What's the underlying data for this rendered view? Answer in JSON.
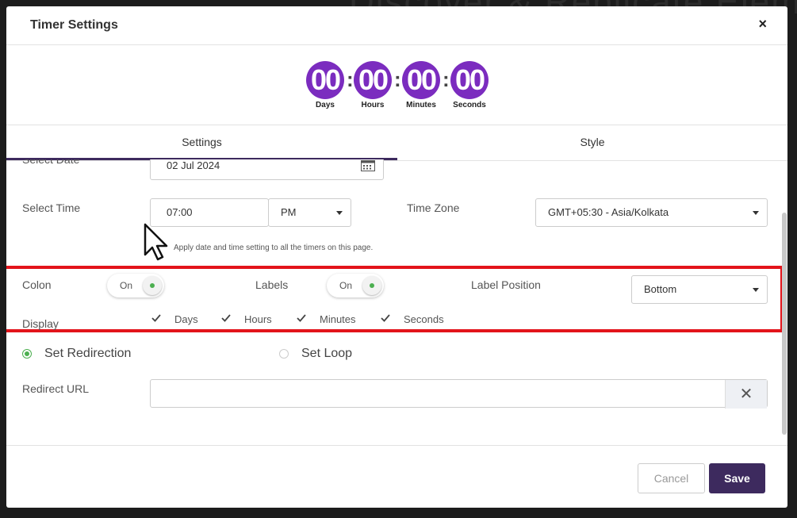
{
  "background_heading": "Discover & Replicate Elem",
  "modal": {
    "title": "Timer Settings",
    "close_glyph": "×"
  },
  "preview": {
    "units": [
      {
        "value": "00",
        "label": "Days"
      },
      {
        "value": "00",
        "label": "Hours"
      },
      {
        "value": "00",
        "label": "Minutes"
      },
      {
        "value": "00",
        "label": "Seconds"
      }
    ],
    "separator": ":",
    "accent_color": "#7b2cbf"
  },
  "tabs": {
    "settings": "Settings",
    "style": "Style",
    "active": "Settings"
  },
  "form": {
    "select_date_label": "Select Date",
    "date_value": "02 Jul 2024",
    "select_time_label": "Select Time",
    "time_value": "07:00",
    "ampm_value": "PM",
    "timezone_label": "Time Zone",
    "timezone_value": "GMT+05:30 - Asia/Kolkata",
    "apply_hint": "Apply date and time setting to all the timers on this page.",
    "colon_label": "Colon",
    "colon_toggle": "On",
    "labels_label": "Labels",
    "labels_toggle": "On",
    "label_position_label": "Label Position",
    "label_position_value": "Bottom",
    "display_label": "Display",
    "display_options": [
      {
        "label": "Days",
        "checked": true
      },
      {
        "label": "Hours",
        "checked": true
      },
      {
        "label": "Minutes",
        "checked": true
      },
      {
        "label": "Seconds",
        "checked": true
      }
    ],
    "redirection_label": "Set Redirection",
    "loop_label": "Set Loop",
    "redirect_url_label": "Redirect URL",
    "redirect_url_value": "",
    "clear_glyph": "✕"
  },
  "footer": {
    "cancel": "Cancel",
    "save": "Save"
  },
  "colors": {
    "primary": "#3d2a5e",
    "highlight": "#e3141b",
    "toggle_on": "#4caf50"
  }
}
